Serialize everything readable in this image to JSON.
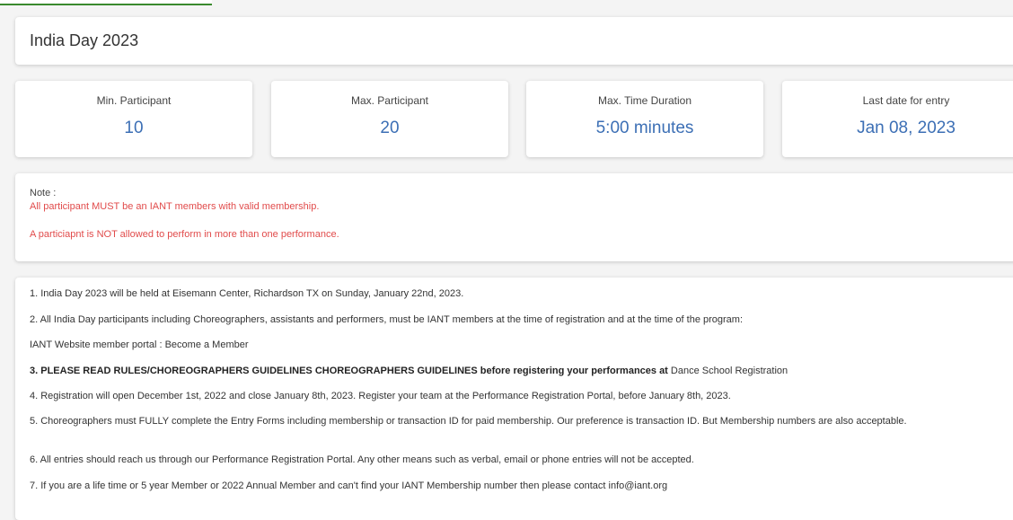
{
  "event": {
    "title": "India Day 2023"
  },
  "stats": [
    {
      "label": "Min. Participant",
      "value": "10"
    },
    {
      "label": "Max. Participant",
      "value": "20"
    },
    {
      "label": "Max. Time Duration",
      "value": "5:00 minutes"
    },
    {
      "label": "Last date for entry",
      "value": "Jan 08, 2023"
    }
  ],
  "note": {
    "label": "Note :",
    "line1": "All participant MUST be an IANT members with valid membership.",
    "line2": "A particiapnt is NOT allowed to perform in more than one performance."
  },
  "rules": {
    "r1": "1. India Day 2023 will be held at Eisemann Center, Richardson TX on Sunday, January 22nd, 2023.",
    "r2": "2. All India Day participants including Choreographers, assistants and performers, must be IANT members at the time of registration and at the time of the program:",
    "r3": "IANT Website member portal : Become a Member",
    "r4_bold": "3. PLEASE READ RULES/CHOREOGRAPHERS GUIDELINES CHOREOGRAPHERS GUIDELINES before registering your performances at",
    "r4_link": " Dance School Registration",
    "r5": "4. Registration will open December 1st, 2022 and close January 8th, 2023. Register your team at the Performance Registration Portal, before January 8th, 2023.",
    "r6": "5. Choreographers must FULLY complete the Entry Forms including membership or transaction ID for paid membership. Our preference is transaction ID. But Membership numbers are also acceptable.",
    "r7": "6. All entries should reach us through our Performance Registration Portal. Any other means such as verbal, email or phone entries will not be accepted.",
    "r8": "7. If you are a life time or 5 year Member or 2022 Annual Member and can't find your IANT Membership number then please contact info@iant.org"
  }
}
